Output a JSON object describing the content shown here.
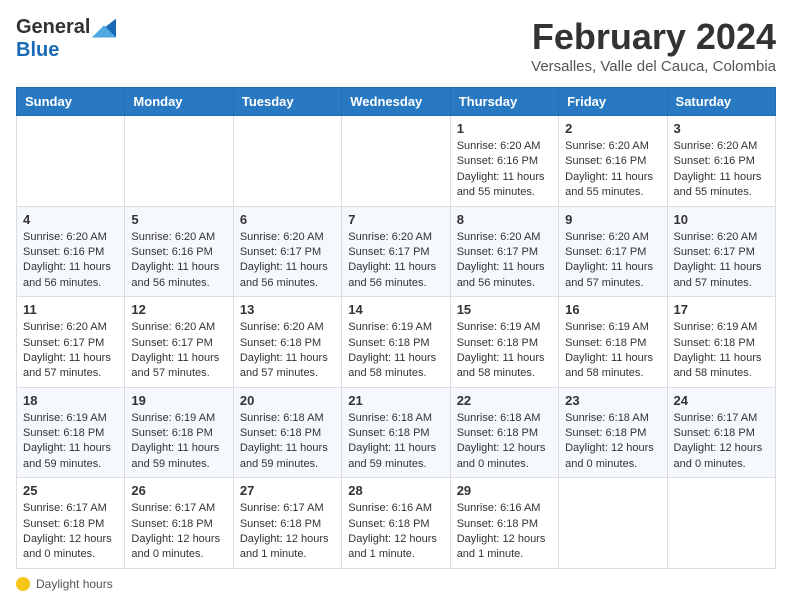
{
  "header": {
    "logo_general": "General",
    "logo_blue": "Blue",
    "month_title": "February 2024",
    "location": "Versalles, Valle del Cauca, Colombia"
  },
  "weekdays": [
    "Sunday",
    "Monday",
    "Tuesday",
    "Wednesday",
    "Thursday",
    "Friday",
    "Saturday"
  ],
  "weeks": [
    [
      {
        "day": "",
        "info": ""
      },
      {
        "day": "",
        "info": ""
      },
      {
        "day": "",
        "info": ""
      },
      {
        "day": "",
        "info": ""
      },
      {
        "day": "1",
        "info": "Sunrise: 6:20 AM\nSunset: 6:16 PM\nDaylight: 11 hours and 55 minutes."
      },
      {
        "day": "2",
        "info": "Sunrise: 6:20 AM\nSunset: 6:16 PM\nDaylight: 11 hours and 55 minutes."
      },
      {
        "day": "3",
        "info": "Sunrise: 6:20 AM\nSunset: 6:16 PM\nDaylight: 11 hours and 55 minutes."
      }
    ],
    [
      {
        "day": "4",
        "info": "Sunrise: 6:20 AM\nSunset: 6:16 PM\nDaylight: 11 hours and 56 minutes."
      },
      {
        "day": "5",
        "info": "Sunrise: 6:20 AM\nSunset: 6:16 PM\nDaylight: 11 hours and 56 minutes."
      },
      {
        "day": "6",
        "info": "Sunrise: 6:20 AM\nSunset: 6:17 PM\nDaylight: 11 hours and 56 minutes."
      },
      {
        "day": "7",
        "info": "Sunrise: 6:20 AM\nSunset: 6:17 PM\nDaylight: 11 hours and 56 minutes."
      },
      {
        "day": "8",
        "info": "Sunrise: 6:20 AM\nSunset: 6:17 PM\nDaylight: 11 hours and 56 minutes."
      },
      {
        "day": "9",
        "info": "Sunrise: 6:20 AM\nSunset: 6:17 PM\nDaylight: 11 hours and 57 minutes."
      },
      {
        "day": "10",
        "info": "Sunrise: 6:20 AM\nSunset: 6:17 PM\nDaylight: 11 hours and 57 minutes."
      }
    ],
    [
      {
        "day": "11",
        "info": "Sunrise: 6:20 AM\nSunset: 6:17 PM\nDaylight: 11 hours and 57 minutes."
      },
      {
        "day": "12",
        "info": "Sunrise: 6:20 AM\nSunset: 6:17 PM\nDaylight: 11 hours and 57 minutes."
      },
      {
        "day": "13",
        "info": "Sunrise: 6:20 AM\nSunset: 6:18 PM\nDaylight: 11 hours and 57 minutes."
      },
      {
        "day": "14",
        "info": "Sunrise: 6:19 AM\nSunset: 6:18 PM\nDaylight: 11 hours and 58 minutes."
      },
      {
        "day": "15",
        "info": "Sunrise: 6:19 AM\nSunset: 6:18 PM\nDaylight: 11 hours and 58 minutes."
      },
      {
        "day": "16",
        "info": "Sunrise: 6:19 AM\nSunset: 6:18 PM\nDaylight: 11 hours and 58 minutes."
      },
      {
        "day": "17",
        "info": "Sunrise: 6:19 AM\nSunset: 6:18 PM\nDaylight: 11 hours and 58 minutes."
      }
    ],
    [
      {
        "day": "18",
        "info": "Sunrise: 6:19 AM\nSunset: 6:18 PM\nDaylight: 11 hours and 59 minutes."
      },
      {
        "day": "19",
        "info": "Sunrise: 6:19 AM\nSunset: 6:18 PM\nDaylight: 11 hours and 59 minutes."
      },
      {
        "day": "20",
        "info": "Sunrise: 6:18 AM\nSunset: 6:18 PM\nDaylight: 11 hours and 59 minutes."
      },
      {
        "day": "21",
        "info": "Sunrise: 6:18 AM\nSunset: 6:18 PM\nDaylight: 11 hours and 59 minutes."
      },
      {
        "day": "22",
        "info": "Sunrise: 6:18 AM\nSunset: 6:18 PM\nDaylight: 12 hours and 0 minutes."
      },
      {
        "day": "23",
        "info": "Sunrise: 6:18 AM\nSunset: 6:18 PM\nDaylight: 12 hours and 0 minutes."
      },
      {
        "day": "24",
        "info": "Sunrise: 6:17 AM\nSunset: 6:18 PM\nDaylight: 12 hours and 0 minutes."
      }
    ],
    [
      {
        "day": "25",
        "info": "Sunrise: 6:17 AM\nSunset: 6:18 PM\nDaylight: 12 hours and 0 minutes."
      },
      {
        "day": "26",
        "info": "Sunrise: 6:17 AM\nSunset: 6:18 PM\nDaylight: 12 hours and 0 minutes."
      },
      {
        "day": "27",
        "info": "Sunrise: 6:17 AM\nSunset: 6:18 PM\nDaylight: 12 hours and 1 minute."
      },
      {
        "day": "28",
        "info": "Sunrise: 6:16 AM\nSunset: 6:18 PM\nDaylight: 12 hours and 1 minute."
      },
      {
        "day": "29",
        "info": "Sunrise: 6:16 AM\nSunset: 6:18 PM\nDaylight: 12 hours and 1 minute."
      },
      {
        "day": "",
        "info": ""
      },
      {
        "day": "",
        "info": ""
      }
    ]
  ],
  "footer": {
    "daylight_label": "Daylight hours"
  }
}
